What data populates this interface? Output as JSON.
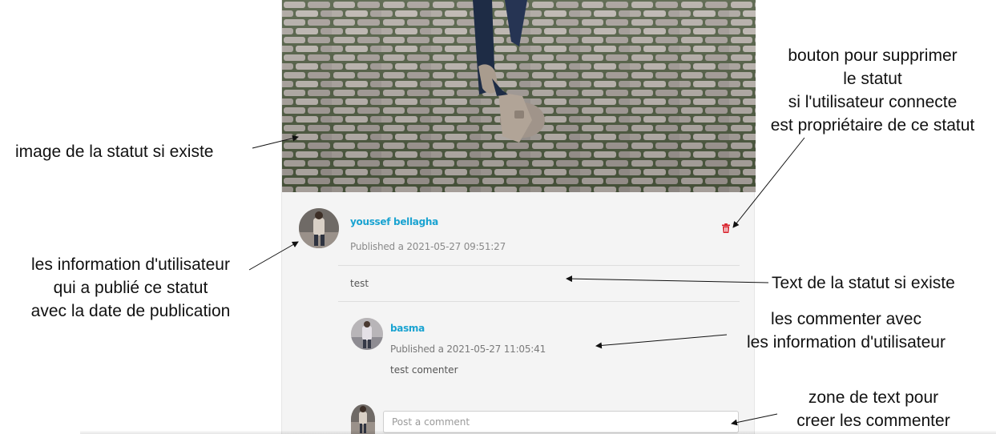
{
  "post": {
    "author_name": "youssef bellagha",
    "published": "Published a 2021-05-27 09:51:27",
    "text": "test",
    "comment": {
      "author": "basma",
      "published": "Published a 2021-05-27 11:05:41",
      "text": "test comenter"
    },
    "comment_input_placeholder": "Post a comment",
    "delete_icon": "trash-icon",
    "accent_color": "#1aa3d1",
    "delete_color": "#d9232d"
  },
  "annotations": {
    "image": "image  de la statut si existe",
    "delete_button": [
      "bouton pour supprimer",
      "le statut",
      "si l'utilisateur connecte",
      "est propriétaire de ce statut"
    ],
    "user_info": [
      "les information d'utilisateur",
      "qui a publié ce statut",
      "avec la date de publication"
    ],
    "status_text": "Text  de la statut si existe",
    "comments": [
      "les commenter avec",
      "les information d'utilisateur"
    ],
    "comment_zone": [
      "zone de text pour",
      "creer les commenter"
    ]
  }
}
